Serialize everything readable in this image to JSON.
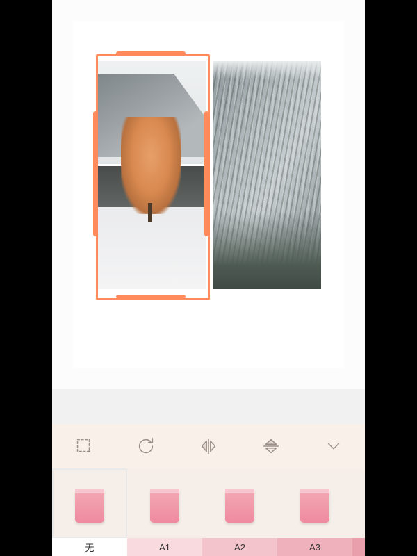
{
  "accent": "#ff8a5c",
  "canvas": {
    "frames": [
      {
        "selected": true,
        "kind": "autumn-tree"
      },
      {
        "selected": false,
        "kind": "snow-forest"
      }
    ]
  },
  "toolbar": {
    "icons": [
      "crop-icon",
      "rotate-icon",
      "flip-horizontal-icon",
      "flip-vertical-icon",
      "chevron-down-icon"
    ]
  },
  "filters": {
    "items": [
      {
        "id": "none",
        "label": "无",
        "selected": true,
        "tone": "pk0"
      },
      {
        "id": "a1",
        "label": "A1",
        "selected": false,
        "tone": "pk1"
      },
      {
        "id": "a2",
        "label": "A2",
        "selected": false,
        "tone": "pk2"
      },
      {
        "id": "a3",
        "label": "A3",
        "selected": false,
        "tone": "pk3"
      }
    ]
  }
}
